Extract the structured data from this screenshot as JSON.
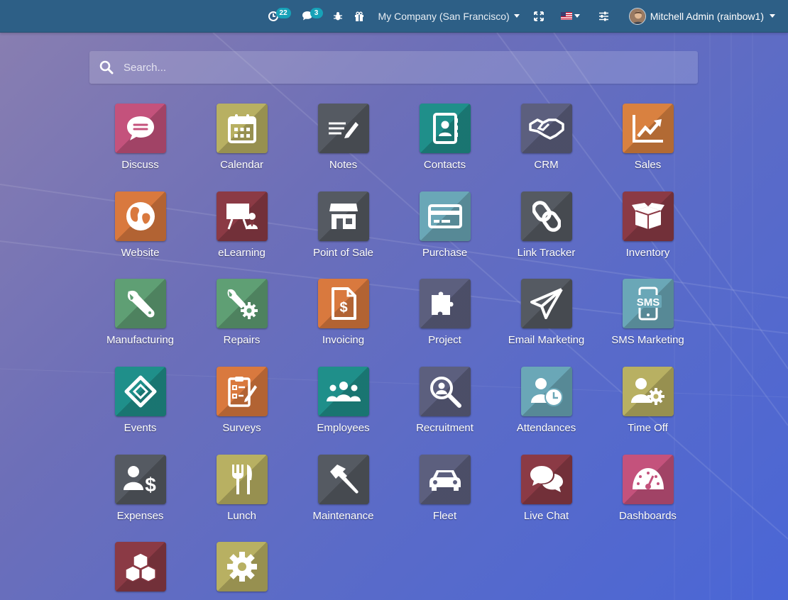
{
  "navbar": {
    "activity_badge": "22",
    "messages_badge": "3",
    "company": "My Company (San Francisco)",
    "user": "Mitchell Admin (rainbow1)"
  },
  "search": {
    "placeholder": "Search..."
  },
  "apps": [
    {
      "label": "Discuss",
      "icon": "chat-bubble-icon",
      "color": "#c4527c"
    },
    {
      "label": "Calendar",
      "icon": "calendar-icon",
      "color": "#b8b062"
    },
    {
      "label": "Notes",
      "icon": "notes-icon",
      "color": "#555a62"
    },
    {
      "label": "Contacts",
      "icon": "contacts-book-icon",
      "color": "#1f8f8a"
    },
    {
      "label": "CRM",
      "icon": "handshake-icon",
      "color": "#5c5f7e"
    },
    {
      "label": "Sales",
      "icon": "trend-chart-icon",
      "color": "#d98140"
    },
    {
      "label": "Website",
      "icon": "globe-icon",
      "color": "#d9793e"
    },
    {
      "label": "eLearning",
      "icon": "teacher-board-icon",
      "color": "#8b3a45"
    },
    {
      "label": "Point of Sale",
      "icon": "shop-icon",
      "color": "#555a62"
    },
    {
      "label": "Purchase",
      "icon": "credit-card-icon",
      "color": "#6aa7b7"
    },
    {
      "label": "Link Tracker",
      "icon": "chain-link-icon",
      "color": "#555a62"
    },
    {
      "label": "Inventory",
      "icon": "box-icon",
      "color": "#8b3a45"
    },
    {
      "label": "Manufacturing",
      "icon": "wrench-icon",
      "color": "#5f9f74"
    },
    {
      "label": "Repairs",
      "icon": "wrench-gear-icon",
      "color": "#5f9f74"
    },
    {
      "label": "Invoicing",
      "icon": "invoice-icon",
      "color": "#d9793e"
    },
    {
      "label": "Project",
      "icon": "puzzle-icon",
      "color": "#5c5f7e"
    },
    {
      "label": "Email Marketing",
      "icon": "paper-plane-icon",
      "color": "#555a62"
    },
    {
      "label": "SMS Marketing",
      "icon": "sms-phone-icon",
      "color": "#6aa7b7"
    },
    {
      "label": "Events",
      "icon": "ticket-icon",
      "color": "#1f8f8a"
    },
    {
      "label": "Surveys",
      "icon": "clipboard-check-icon",
      "color": "#d9793e"
    },
    {
      "label": "Employees",
      "icon": "people-group-icon",
      "color": "#1f8f8a"
    },
    {
      "label": "Recruitment",
      "icon": "magnifier-icon",
      "color": "#5c5f7e"
    },
    {
      "label": "Attendances",
      "icon": "user-clock-icon",
      "color": "#6aa7b7"
    },
    {
      "label": "Time Off",
      "icon": "user-gear-icon",
      "color": "#b8b062"
    },
    {
      "label": "Expenses",
      "icon": "user-dollar-icon",
      "color": "#555a62"
    },
    {
      "label": "Lunch",
      "icon": "fork-knife-icon",
      "color": "#b8b062"
    },
    {
      "label": "Maintenance",
      "icon": "hammer-icon",
      "color": "#555a62"
    },
    {
      "label": "Fleet",
      "icon": "car-icon",
      "color": "#5c5f7e"
    },
    {
      "label": "Live Chat",
      "icon": "chat-bubbles-icon",
      "color": "#8b3a45"
    },
    {
      "label": "Dashboards",
      "icon": "gauge-icon",
      "color": "#c4527c"
    },
    {
      "label": "",
      "icon": "cubes-icon",
      "color": "#8b3a45"
    },
    {
      "label": "",
      "icon": "gear-icon",
      "color": "#b8b062"
    }
  ]
}
